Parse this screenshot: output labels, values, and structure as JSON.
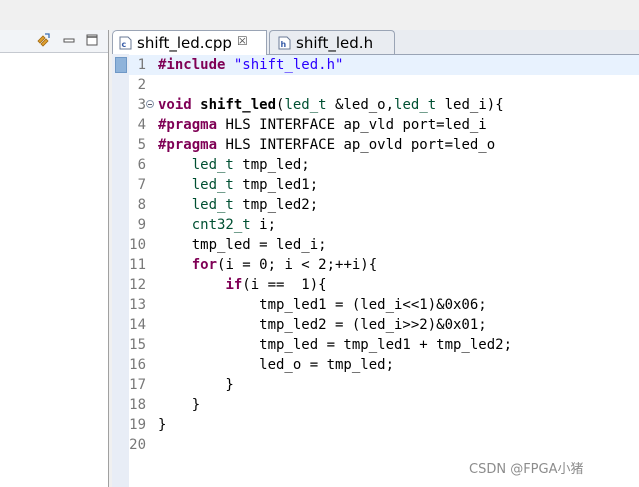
{
  "left_panel": {
    "icons": [
      "link-with-editor-icon",
      "minimize-icon",
      "maximize-icon"
    ]
  },
  "editor": {
    "tabs": [
      {
        "label": "shift_led.cpp",
        "icon": "cpp-file-icon",
        "active": true,
        "close_glyph": "☒"
      },
      {
        "label": "shift_led.h",
        "icon": "header-file-icon",
        "active": false
      }
    ],
    "current_line": 1,
    "lines": [
      {
        "n": "1",
        "tokens": [
          [
            "kw",
            "#include"
          ],
          [
            "t",
            " "
          ],
          [
            "str",
            "\"shift_led.h\""
          ]
        ]
      },
      {
        "n": "2",
        "tokens": []
      },
      {
        "n": "3",
        "fold": true,
        "tokens": [
          [
            "kw",
            "void"
          ],
          [
            "t",
            " "
          ],
          [
            "b",
            "shift_led"
          ],
          [
            "t",
            "("
          ],
          [
            "type",
            "led_t"
          ],
          [
            "t",
            " &led_o,"
          ],
          [
            "type",
            "led_t"
          ],
          [
            "t",
            " led_i){"
          ]
        ]
      },
      {
        "n": "4",
        "tokens": [
          [
            "kw",
            "#pragma"
          ],
          [
            "t",
            " HLS INTERFACE ap_vld port=led_i"
          ]
        ]
      },
      {
        "n": "5",
        "tokens": [
          [
            "kw",
            "#pragma"
          ],
          [
            "t",
            " HLS INTERFACE ap_ovld port=led_o"
          ]
        ]
      },
      {
        "n": "6",
        "tokens": [
          [
            "t",
            "    "
          ],
          [
            "type",
            "led_t"
          ],
          [
            "t",
            " tmp_led;"
          ]
        ]
      },
      {
        "n": "7",
        "tokens": [
          [
            "t",
            "    "
          ],
          [
            "type",
            "led_t"
          ],
          [
            "t",
            " tmp_led1;"
          ]
        ]
      },
      {
        "n": "8",
        "tokens": [
          [
            "t",
            "    "
          ],
          [
            "type",
            "led_t"
          ],
          [
            "t",
            " tmp_led2;"
          ]
        ]
      },
      {
        "n": "9",
        "tokens": [
          [
            "t",
            "    "
          ],
          [
            "type",
            "cnt32_t"
          ],
          [
            "t",
            " i;"
          ]
        ]
      },
      {
        "n": "10",
        "tokens": [
          [
            "t",
            "    tmp_led = led_i;"
          ]
        ]
      },
      {
        "n": "11",
        "tokens": [
          [
            "t",
            "    "
          ],
          [
            "kw",
            "for"
          ],
          [
            "t",
            "(i = 0; i < 2;++i){"
          ]
        ]
      },
      {
        "n": "12",
        "tokens": [
          [
            "t",
            "        "
          ],
          [
            "kw",
            "if"
          ],
          [
            "t",
            "(i ==  1){"
          ]
        ]
      },
      {
        "n": "13",
        "tokens": [
          [
            "t",
            "            tmp_led1 = (led_i<<1)&0x06;"
          ]
        ]
      },
      {
        "n": "14",
        "tokens": [
          [
            "t",
            "            tmp_led2 = (led_i>>2)&0x01;"
          ]
        ]
      },
      {
        "n": "15",
        "tokens": [
          [
            "t",
            "            tmp_led = tmp_led1 + tmp_led2;"
          ]
        ]
      },
      {
        "n": "16",
        "tokens": [
          [
            "t",
            "            led_o = tmp_led;"
          ]
        ]
      },
      {
        "n": "17",
        "tokens": [
          [
            "t",
            "        }"
          ]
        ]
      },
      {
        "n": "18",
        "tokens": [
          [
            "t",
            "    }"
          ]
        ]
      },
      {
        "n": "19",
        "tokens": [
          [
            "t",
            "}"
          ]
        ]
      },
      {
        "n": "20",
        "tokens": []
      }
    ]
  },
  "watermark": "CSDN @FPGA小猪",
  "colors": {
    "keyword": "#7f0055",
    "string": "#2a00ff",
    "type": "#005032",
    "line_number": "#787878",
    "current_line_bg": "#e8f2fe"
  }
}
